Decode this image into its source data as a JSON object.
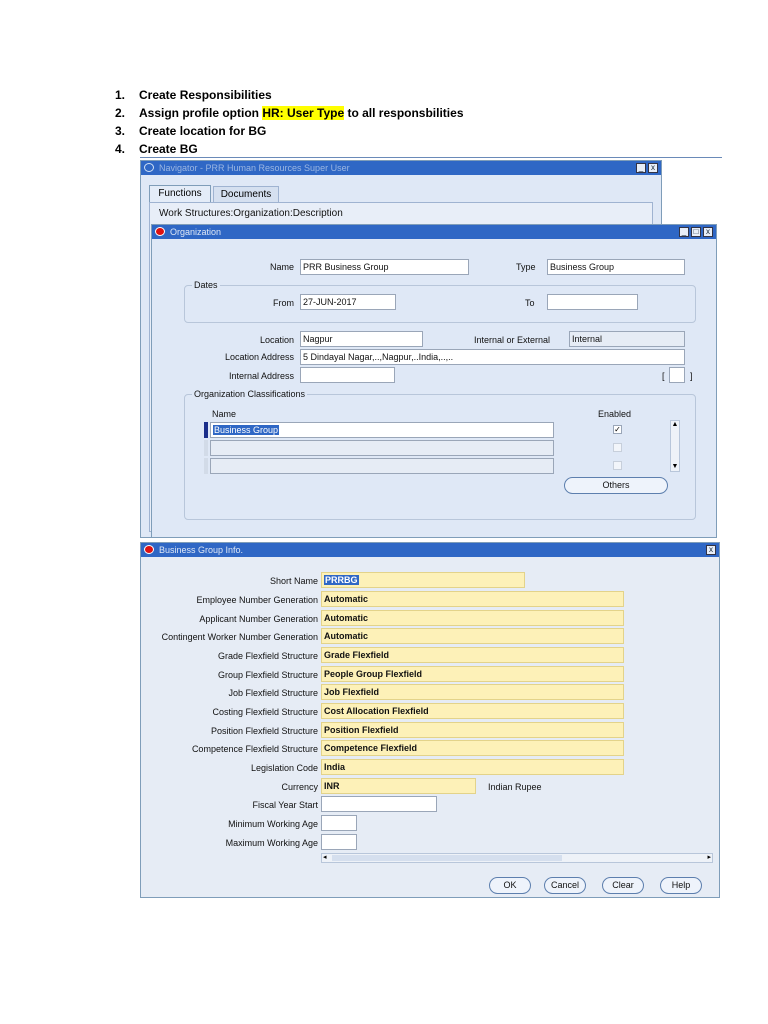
{
  "instructions": {
    "items": [
      {
        "num": "1.",
        "text": "Create Responsibilities"
      },
      {
        "num": "2.",
        "before": "Assign profile option ",
        "highlight": "HR: User Type",
        "after": " to all responsbilities"
      },
      {
        "num": "3.",
        "text": "Create location for BG"
      },
      {
        "num": "4.",
        "text": "Create BG"
      }
    ]
  },
  "navigator": {
    "title": "Navigator - PRR Human Resources Super User",
    "tabs": [
      "Functions",
      "Documents"
    ],
    "path": "Work Structures:Organization:Description"
  },
  "organization": {
    "title": "Organization",
    "name_label": "Name",
    "name_value": "PRR Business Group",
    "type_label": "Type",
    "type_value": "Business Group",
    "dates_label": "Dates",
    "from_label": "From",
    "from_value": "27-JUN-2017",
    "to_label": "To",
    "to_value": "",
    "location_label": "Location",
    "location_value": "Nagpur",
    "internal_external_label": "Internal or External",
    "internal_external_value": "Internal",
    "location_address_label": "Location Address",
    "location_address_value": "5 Dindayal Nagar,..,Nagpur,..India,..,..",
    "internal_address_label": "Internal Address",
    "internal_address_value": "",
    "bracket_open": "[",
    "bracket_close": "]",
    "classifications_label": "Organization Classifications",
    "col_name": "Name",
    "col_enabled": "Enabled",
    "rows": [
      {
        "name": "Business Group",
        "enabled": true
      },
      {
        "name": "",
        "enabled": false
      },
      {
        "name": "",
        "enabled": false
      }
    ],
    "others_button": "Others"
  },
  "bg_info": {
    "title": "Business Group Info.",
    "fields": [
      {
        "label": "Short Name",
        "value": "PRRBG"
      },
      {
        "label": "Employee Number Generation",
        "value": "Automatic"
      },
      {
        "label": "Applicant Number Generation",
        "value": "Automatic"
      },
      {
        "label": "Contingent Worker Number Generation",
        "value": "Automatic"
      },
      {
        "label": "Grade Flexfield Structure",
        "value": "Grade Flexfield"
      },
      {
        "label": "Group Flexfield Structure",
        "value": "People Group Flexfield"
      },
      {
        "label": "Job Flexfield Structure",
        "value": "Job Flexfield"
      },
      {
        "label": "Costing Flexfield Structure",
        "value": "Cost Allocation Flexfield"
      },
      {
        "label": "Position Flexfield Structure",
        "value": "Position Flexfield"
      },
      {
        "label": "Competence Flexfield Structure",
        "value": "Competence Flexfield"
      },
      {
        "label": "Legislation Code",
        "value": "India"
      },
      {
        "label": "Currency",
        "value": "INR"
      },
      {
        "label": "Fiscal Year Start",
        "value": ""
      },
      {
        "label": "Minimum Working Age",
        "value": ""
      },
      {
        "label": "Maximum Working Age",
        "value": ""
      }
    ],
    "currency_desc": "Indian Rupee",
    "buttons": {
      "ok": "OK",
      "cancel": "Cancel",
      "clear": "Clear",
      "help": "Help"
    }
  }
}
